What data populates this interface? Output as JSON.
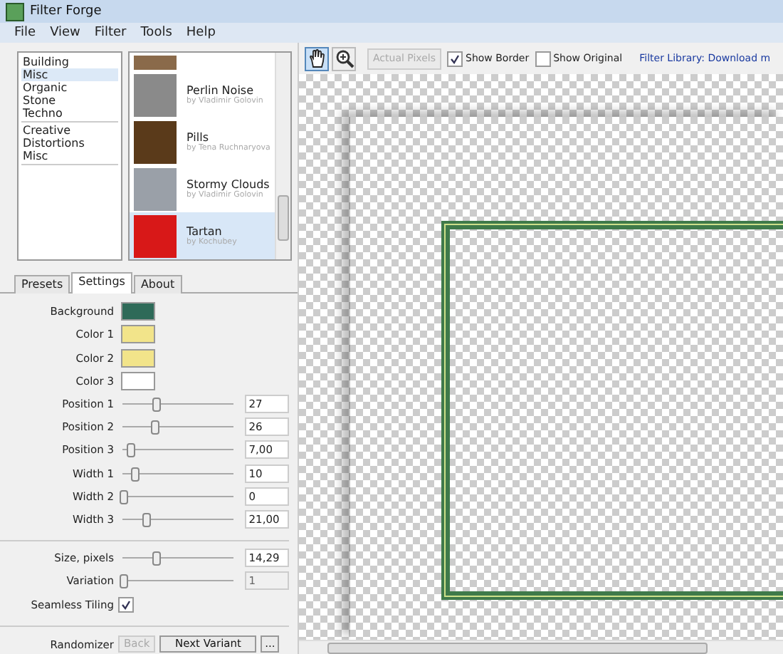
{
  "window": {
    "title": "Filter Forge"
  },
  "menu": [
    "File",
    "View",
    "Filter",
    "Tools",
    "Help"
  ],
  "categories": [
    {
      "label": "Building",
      "selected": false,
      "separator_before": false
    },
    {
      "label": "Misc",
      "selected": true,
      "separator_before": false
    },
    {
      "label": "Organic",
      "selected": false,
      "separator_before": false
    },
    {
      "label": "Stone",
      "selected": false,
      "separator_before": false
    },
    {
      "label": "Techno",
      "selected": false,
      "separator_before": false
    },
    {
      "label": "Creative",
      "selected": false,
      "separator_before": true
    },
    {
      "label": "Distortions",
      "selected": false,
      "separator_before": false
    },
    {
      "label": "Misc",
      "selected": false,
      "separator_before": false
    }
  ],
  "filters": [
    {
      "name": "Perlin Noise",
      "author": "by Vladimir Golovin",
      "selected": false,
      "color": "#8a8a8a"
    },
    {
      "name": "Pills",
      "author": "by Tena Ruchnaryova",
      "selected": false,
      "color": "#5a3a1a"
    },
    {
      "name": "Stormy Clouds",
      "author": "by Vladimir Golovin",
      "selected": false,
      "color": "#9aa0a8"
    },
    {
      "name": "Tartan",
      "author": "by Kochubey",
      "selected": true,
      "color": "#d81818"
    }
  ],
  "tabs": [
    {
      "label": "Presets",
      "selected": false
    },
    {
      "label": "Settings",
      "selected": true
    },
    {
      "label": "About",
      "selected": false
    }
  ],
  "colors": [
    {
      "label": "Background",
      "color": "#2e6a58"
    },
    {
      "label": "Color 1",
      "color": "#f2e48a"
    },
    {
      "label": "Color 2",
      "color": "#f2e48a"
    },
    {
      "label": "Color 3",
      "color": "#ffffff"
    }
  ],
  "sliders": [
    {
      "label": "Position 1",
      "level": 0.3,
      "value": "27"
    },
    {
      "label": "Position 2",
      "level": 0.28,
      "value": "26"
    },
    {
      "label": "Position 3",
      "level": 0.07,
      "value": "7,00"
    },
    {
      "label": "Width 1",
      "level": 0.1,
      "value": "10"
    },
    {
      "label": "Width 2",
      "level": 0,
      "value": "0"
    },
    {
      "label": "Width 3",
      "level": 0.2,
      "value": "21,00"
    }
  ],
  "size": {
    "label": "Size, pixels",
    "level": 0.3,
    "value": "14,29"
  },
  "variation": {
    "label": "Variation",
    "level": 0,
    "value": "1",
    "disabled": true
  },
  "seamless": {
    "label": "Seamless Tiling",
    "checked": true
  },
  "randomizer": {
    "label": "Randomizer",
    "back": "Back",
    "back_disabled": true,
    "next": "Next Variant",
    "more": "..."
  },
  "toolbar": {
    "hand_selected": true,
    "actual_pixels": "Actual Pixels",
    "show_border": {
      "label": "Show Border",
      "checked": true
    },
    "show_original": {
      "label": "Show Original",
      "checked": false
    },
    "library": "Filter Library: Download m"
  }
}
